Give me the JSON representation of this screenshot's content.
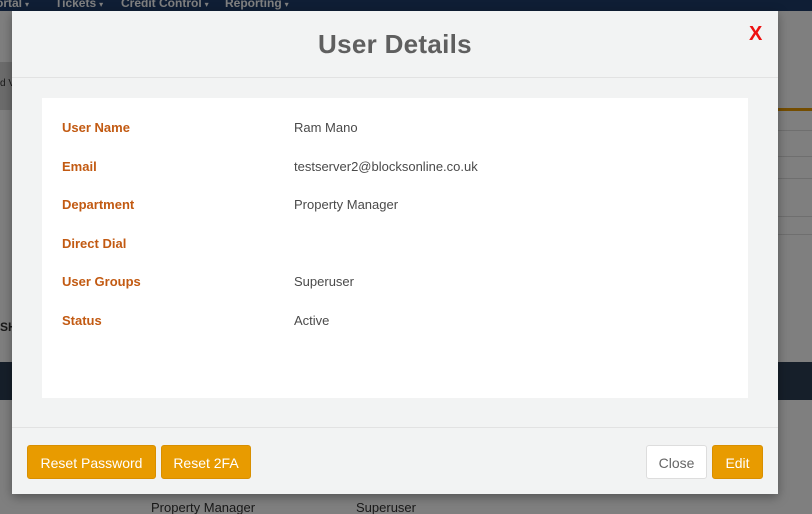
{
  "background": {
    "nav_items": [
      {
        "label": "ortal",
        "caret": "▾"
      },
      {
        "label": "Tickets",
        "caret": "▾"
      },
      {
        "label": "Credit Control",
        "caret": "▾"
      },
      {
        "label": "Reporting",
        "caret": "▾"
      }
    ],
    "left_fragment": "d V",
    "left_heading_fragment": "SH",
    "bottom_row": [
      "Property Manager",
      "Superuser"
    ]
  },
  "modal": {
    "title": "User Details",
    "close_label": "X",
    "fields": [
      {
        "label": "User Name",
        "value": "Ram Mano"
      },
      {
        "label": "Email",
        "value": "testserver2@blocksonline.co.uk"
      },
      {
        "label": "Department",
        "value": "Property Manager"
      },
      {
        "label": "Direct Dial",
        "value": ""
      },
      {
        "label": "User Groups",
        "value": "Superuser"
      },
      {
        "label": "Status",
        "value": "Active"
      }
    ],
    "buttons": {
      "reset_password": "Reset Password",
      "reset_2fa": "Reset 2FA",
      "close": "Close",
      "edit": "Edit"
    }
  },
  "colors": {
    "accent": "#e89b00",
    "label": "#c25a12",
    "close_x": "#ee1010",
    "nav": "#1f3d6b"
  }
}
